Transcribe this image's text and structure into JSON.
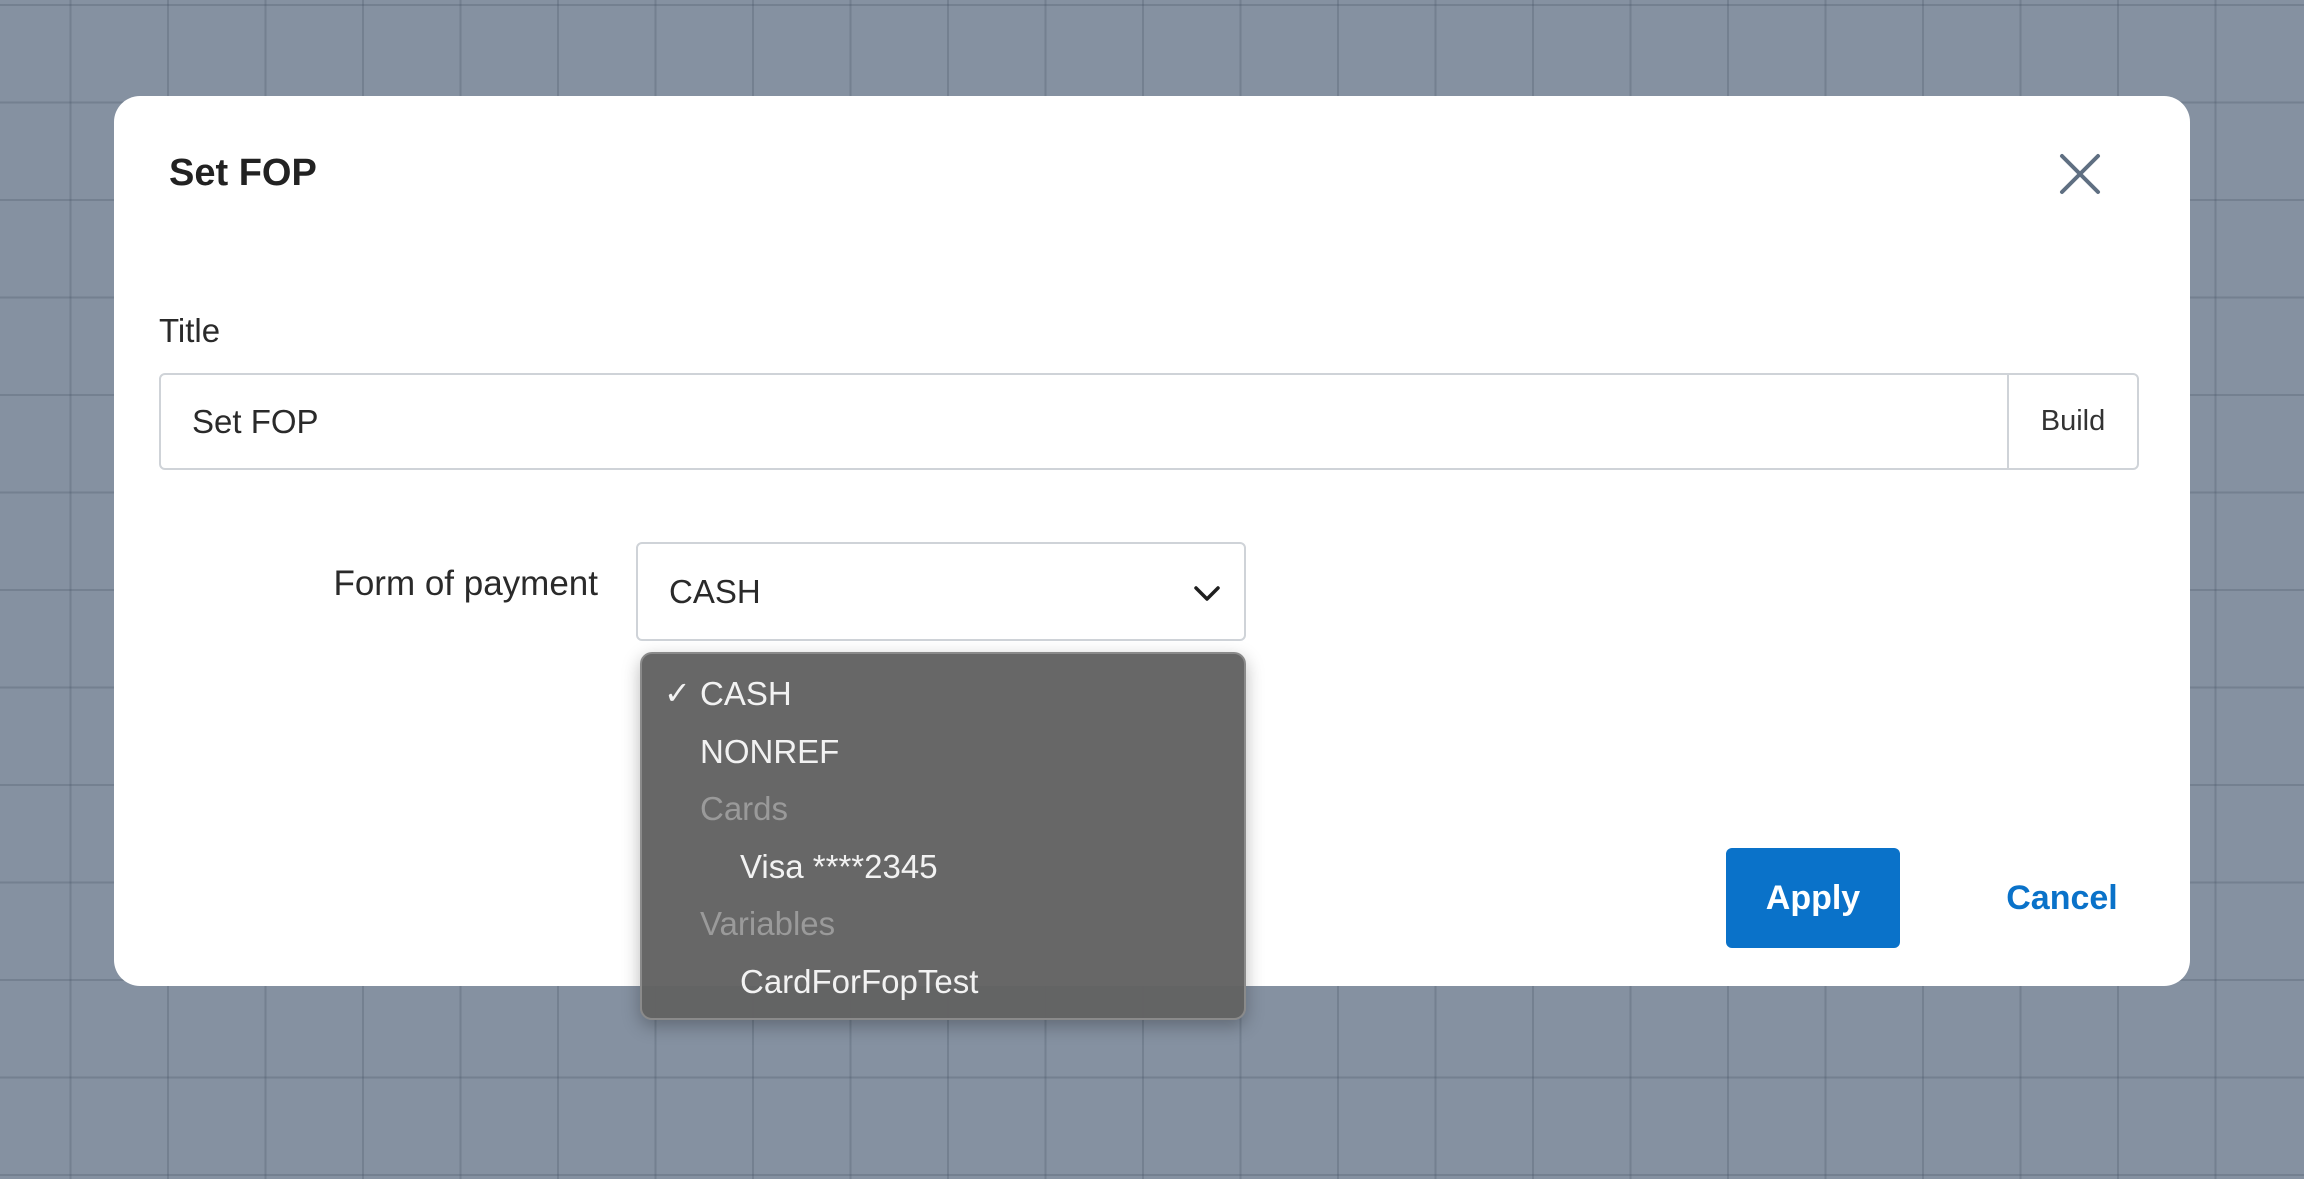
{
  "dialog": {
    "title": "Set FOP",
    "close_icon": "close-icon",
    "title_field": {
      "label": "Title",
      "value": "Set FOP",
      "build_label": "Build"
    },
    "fop": {
      "label": "Form of payment",
      "selected": "CASH",
      "chevron_icon": "chevron-down-icon"
    },
    "apply_label": "Apply",
    "cancel_label": "Cancel"
  },
  "dropdown": {
    "check_icon": "checkmark-icon",
    "check_glyph": "✓",
    "items": [
      {
        "label": "CASH",
        "type": "option",
        "selected": true
      },
      {
        "label": "NONREF",
        "type": "option",
        "selected": false
      },
      {
        "label": "Cards",
        "type": "group-header"
      },
      {
        "label": "Visa ****2345",
        "type": "option",
        "indent": true,
        "selected": false
      },
      {
        "label": "Variables",
        "type": "group-header"
      },
      {
        "label": "CardForFopTest",
        "type": "option",
        "indent": true,
        "selected": false
      }
    ]
  },
  "colors": {
    "backdrop": "#8591a1",
    "dialog_background": "#ffffff",
    "accent": "#0a72c9",
    "dropdown_background": "#626262",
    "dropdown_header_text": "#9a9a9a",
    "border": "#cfd3d8"
  }
}
